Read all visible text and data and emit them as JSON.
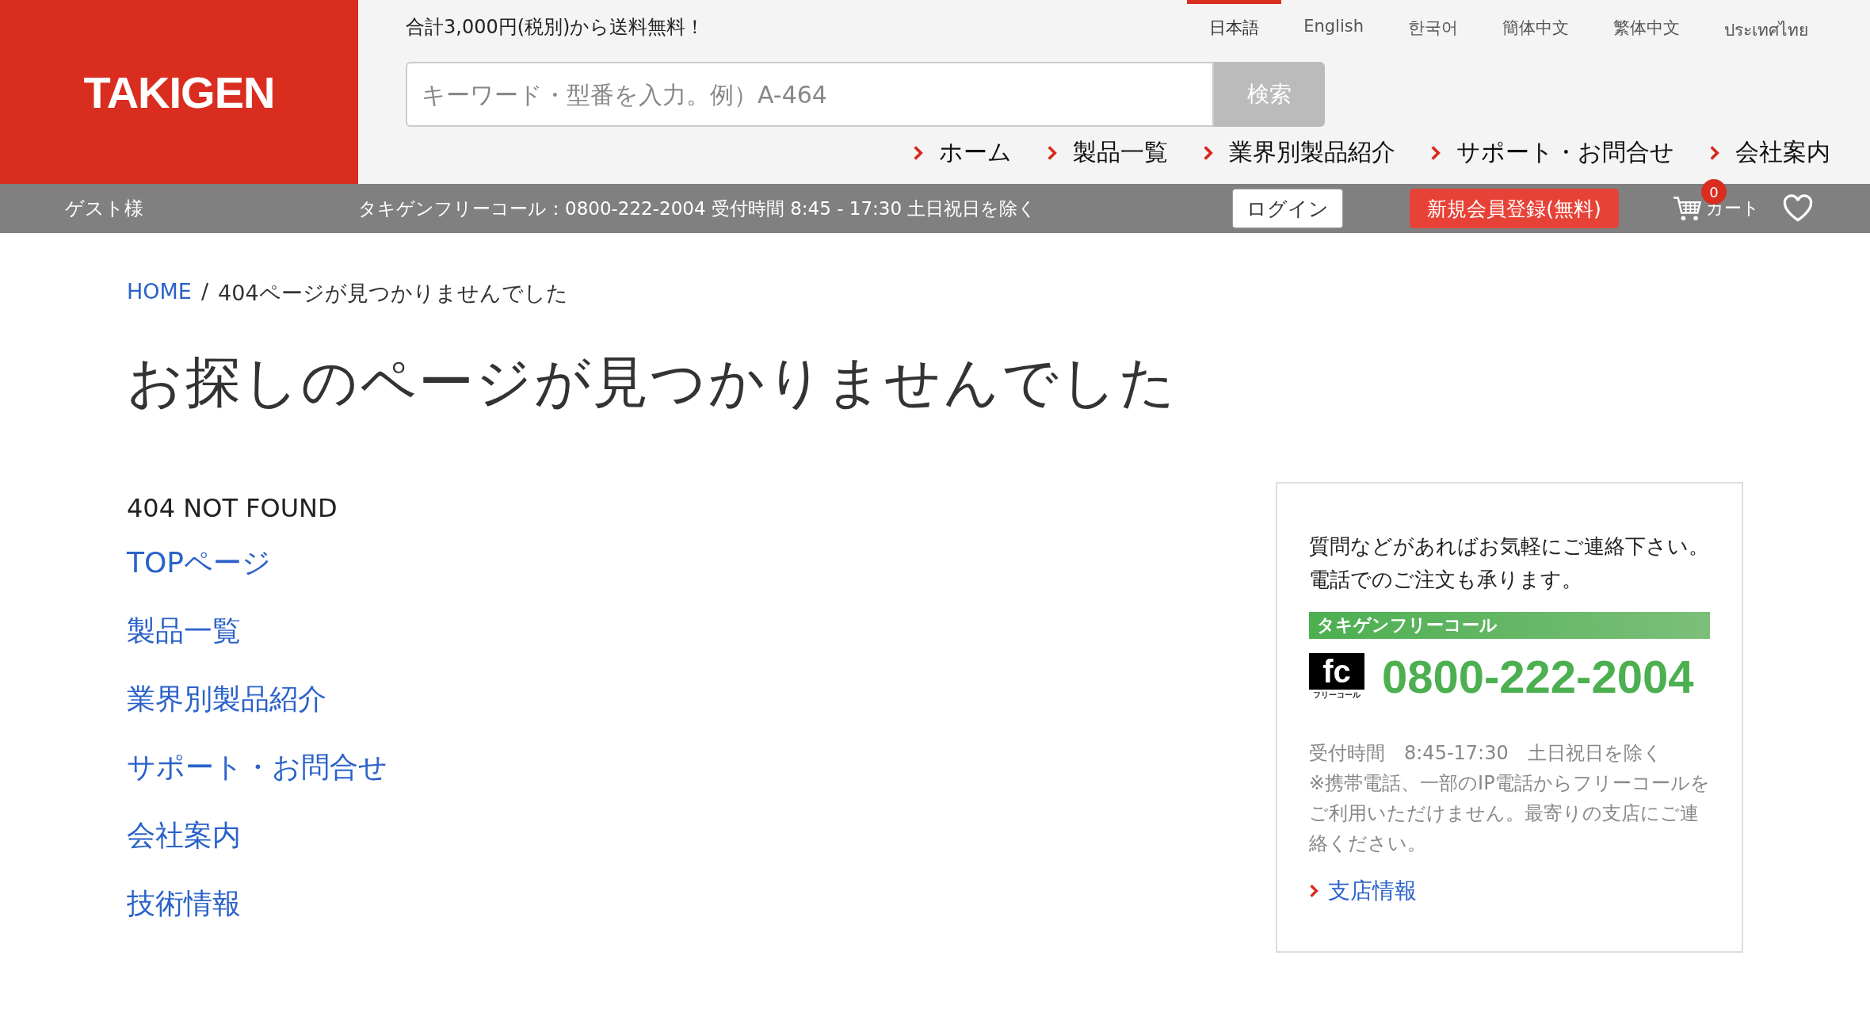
{
  "header": {
    "logo": "TAKIGEN",
    "shipping_note": "合計3,000円(税別)から送料無料！",
    "languages": [
      {
        "label": "日本語",
        "selected": true
      },
      {
        "label": "English",
        "selected": false
      },
      {
        "label": "한국어",
        "selected": false
      },
      {
        "label": "簡体中文",
        "selected": false
      },
      {
        "label": "繁体中文",
        "selected": false
      },
      {
        "label": "ประเทศไทย",
        "selected": false
      }
    ],
    "search": {
      "placeholder": "キーワード・型番を入力。例）A-464",
      "button": "検索"
    },
    "nav": [
      "ホーム",
      "製品一覧",
      "業界別製品紹介",
      "サポート・お問合せ",
      "会社案内"
    ]
  },
  "user_bar": {
    "guest": "ゲスト様",
    "free_call": "タキゲンフリーコール：0800-222-2004 受付時間 8:45 - 17:30 土日祝日を除く",
    "login": "ログイン",
    "register": "新規会員登録(無料)",
    "cart_count": "0",
    "cart": "カート"
  },
  "breadcrumb": {
    "home": "HOME",
    "separator": "/",
    "current": "404ページが見つかりませんでした"
  },
  "title": "お探しのページが見つかりませんでした",
  "status": "404 NOT FOUND",
  "links": [
    "TOPページ",
    "製品一覧",
    "業界別製品紹介",
    "サポート・お問合せ",
    "会社案内",
    "技術情報"
  ],
  "contact_box": {
    "intro": "質問などがあればお気軽にご連絡下さい。電話でのご注文も承ります。",
    "banner": "タキゲンフリーコール",
    "logo_mark": "fc",
    "logo_caption": "フリーコール",
    "phone": "0800-222-2004",
    "hours": "受付時間　8:45-17:30　土日祝日を除く",
    "note": "※携帯電話、一部のIP電話からフリーコールをご利用いただけません。最寄りの支店にご連絡ください。",
    "branch_link": "支店情報"
  }
}
